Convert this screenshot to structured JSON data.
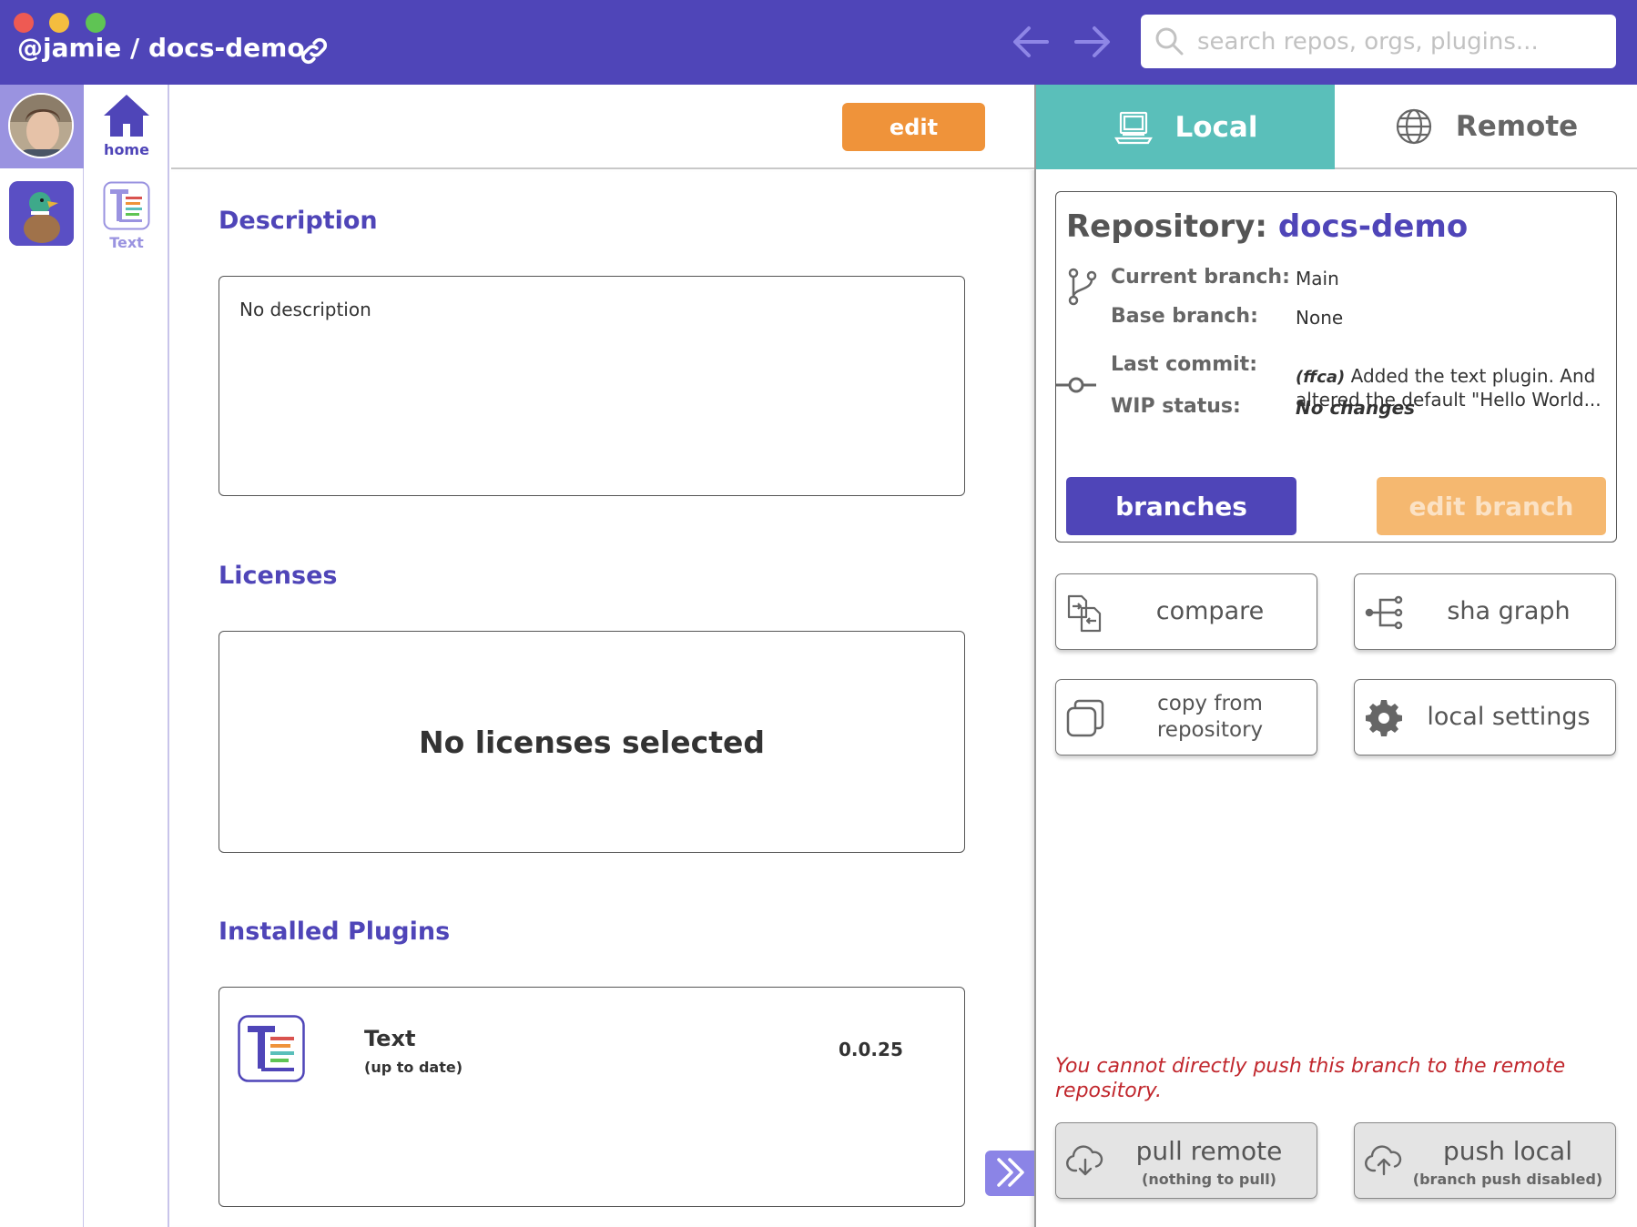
{
  "window": {
    "title": "@jamie / docs-demo",
    "search_placeholder": "search repos, orgs, plugins..."
  },
  "plugin_column": {
    "home_label": "home",
    "text_plugin_label": "Text"
  },
  "main": {
    "edit_label": "edit",
    "description_title": "Description",
    "description_text": "No description",
    "licenses_title": "Licenses",
    "licenses_empty": "No licenses selected",
    "plugins_title": "Installed Plugins",
    "plugins": [
      {
        "name": "Text",
        "status": "(up to date)",
        "version": "0.0.25"
      }
    ]
  },
  "right_panel": {
    "tabs": [
      {
        "label": "Local",
        "icon": "laptop-icon",
        "active": true
      },
      {
        "label": "Remote",
        "icon": "globe-icon",
        "active": false
      }
    ],
    "repo_label": "Repository:",
    "repo_name": "docs-demo",
    "current_branch_label": "Current branch:",
    "current_branch": "Main",
    "base_branch_label": "Base branch:",
    "base_branch": "None",
    "last_commit_label": "Last commit:",
    "last_commit_hash": "(ffca)",
    "last_commit_message": "Added the text plugin. And altered the default \"Hello World...",
    "wip_label": "WIP status:",
    "wip_status": "No changes",
    "branches_label": "branches",
    "edit_branch_label": "edit branch",
    "actions": {
      "compare": "compare",
      "sha_graph": "sha graph",
      "copy_from_repo": "copy from repository",
      "local_settings": "local settings"
    },
    "warning": "You cannot directly push this branch to the remote repository.",
    "pull_label": "pull remote",
    "pull_sub": "(nothing to pull)",
    "push_label": "push local",
    "push_sub": "(branch push disabled)"
  },
  "colors": {
    "brand": "#4f45b8",
    "accent_orange": "#ef933a",
    "local_tab": "#5abfba",
    "warning": "#c1272d"
  }
}
